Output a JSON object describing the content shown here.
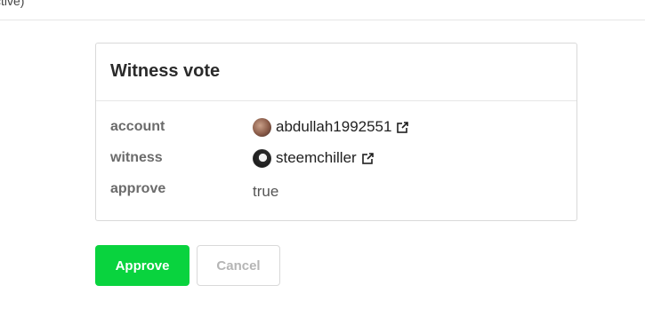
{
  "topbar": {
    "text": "ctive)"
  },
  "card": {
    "title": "Witness vote",
    "rows": [
      {
        "label": "account",
        "value": "abdullah1992551",
        "icon": "external-link-icon"
      },
      {
        "label": "witness",
        "value": "steemchiller",
        "icon": "external-link-icon"
      },
      {
        "label": "approve",
        "value": "true"
      }
    ]
  },
  "actions": {
    "approve_label": "Approve",
    "cancel_label": "Cancel"
  },
  "colors": {
    "approve_bg": "#09d33e",
    "cancel_text": "#b5b5b5"
  }
}
